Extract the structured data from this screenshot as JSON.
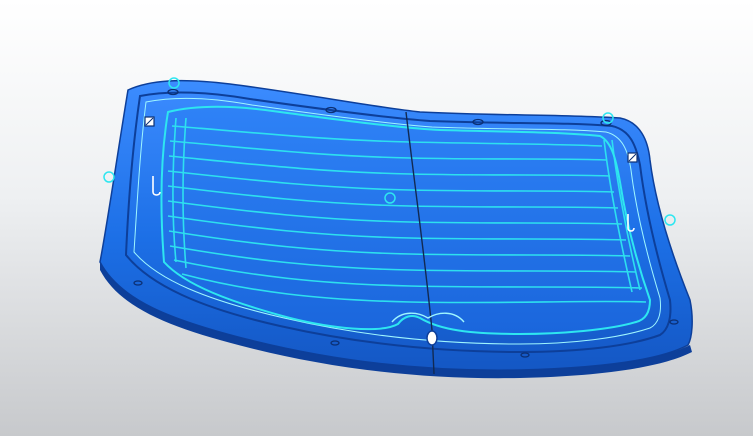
{
  "viewport": {
    "model": "rear-windshield-glass",
    "colors": {
      "background_top": "#ffffff",
      "background_bottom": "#c7c9cc",
      "glass_body": "#1f74e8",
      "glass_edge": "#0d3f9a",
      "heater_grid": "#2ee6f0",
      "annotation_marker": "#2ee6f0",
      "split_line": "#122a52"
    },
    "icons": {
      "corner_marker_left": "square-marker-icon",
      "corner_marker_right": "square-marker-icon",
      "point_marker": "circle-marker-icon",
      "wiper_hole": "ellipse-hole-icon"
    }
  }
}
